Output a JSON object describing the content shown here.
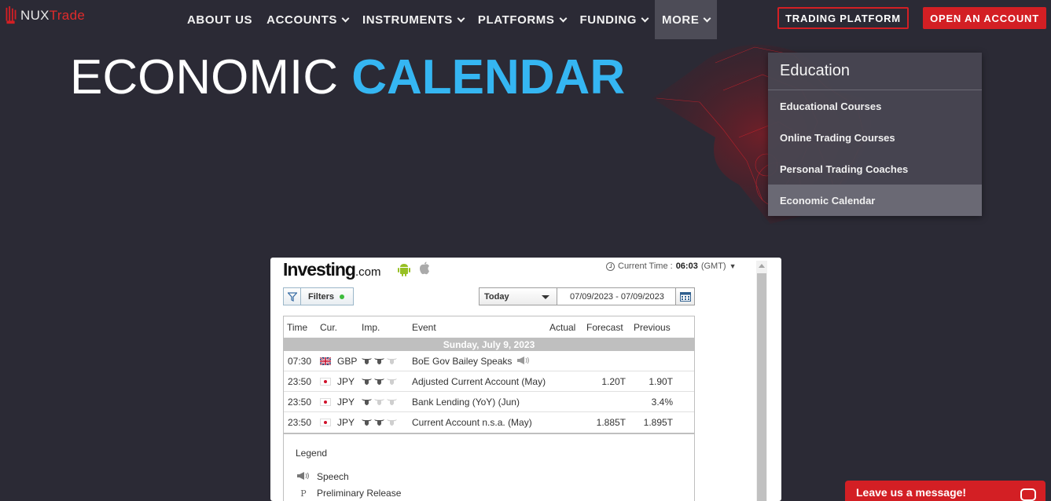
{
  "brand": {
    "name_prefix": "NUX",
    "name_suffix": "Trade"
  },
  "nav": {
    "items": [
      {
        "label": "ABOUT US",
        "has_dropdown": false
      },
      {
        "label": "ACCOUNTS",
        "has_dropdown": true
      },
      {
        "label": "INSTRUMENTS",
        "has_dropdown": true
      },
      {
        "label": "PLATFORMS",
        "has_dropdown": true
      },
      {
        "label": "FUNDING",
        "has_dropdown": true
      },
      {
        "label": "MORE",
        "has_dropdown": true,
        "active": true
      }
    ],
    "trading_platform_label": "TRADING PLATFORM",
    "open_account_label": "OPEN AN ACCOUNT"
  },
  "hero": {
    "title_plain": "ECONOMIC",
    "title_accent": "CALENDAR"
  },
  "dropdown": {
    "heading": "Education",
    "items": [
      {
        "label": "Educational Courses"
      },
      {
        "label": "Online Trading Courses"
      },
      {
        "label": "Personal Trading Coaches"
      },
      {
        "label": "Economic Calendar",
        "active": true
      }
    ]
  },
  "widget": {
    "logo_main": "Investing",
    "logo_suffix": ".com",
    "current_time_label": "Current Time :",
    "current_time_value": "06:03",
    "timezone": "(GMT)",
    "filters_label": "Filters",
    "period_select": "Today",
    "date_range": "07/09/2023 - 07/09/2023",
    "columns": {
      "time": "Time",
      "cur": "Cur.",
      "imp": "Imp.",
      "event": "Event",
      "actual": "Actual",
      "forecast": "Forecast",
      "previous": "Previous"
    },
    "day_header": "Sunday, July 9, 2023",
    "rows": [
      {
        "time": "07:30",
        "flag": "GB",
        "currency": "GBP",
        "importance": 2,
        "event": "BoE Gov Bailey Speaks",
        "speech": true,
        "actual": "",
        "forecast": "",
        "previous": ""
      },
      {
        "time": "23:50",
        "flag": "JP",
        "currency": "JPY",
        "importance": 2,
        "event": "Adjusted Current Account (May)",
        "speech": false,
        "actual": "",
        "forecast": "1.20T",
        "previous": "1.90T"
      },
      {
        "time": "23:50",
        "flag": "JP",
        "currency": "JPY",
        "importance": 1,
        "event": "Bank Lending (YoY) (Jun)",
        "speech": false,
        "actual": "",
        "forecast": "",
        "previous": "3.4%"
      },
      {
        "time": "23:50",
        "flag": "JP",
        "currency": "JPY",
        "importance": 2,
        "event": "Current Account n.s.a. (May)",
        "speech": false,
        "actual": "",
        "forecast": "1.885T",
        "previous": "1.895T"
      }
    ],
    "legend": {
      "title": "Legend",
      "items": [
        {
          "icon": "speech-icon",
          "label": "Speech"
        },
        {
          "icon": "P",
          "label": "Preliminary Release"
        }
      ]
    }
  },
  "chat": {
    "label": "Leave us a message!"
  },
  "colors": {
    "accent_red": "#d31f24",
    "accent_blue": "#35b6f2",
    "background": "#2b2a35"
  }
}
